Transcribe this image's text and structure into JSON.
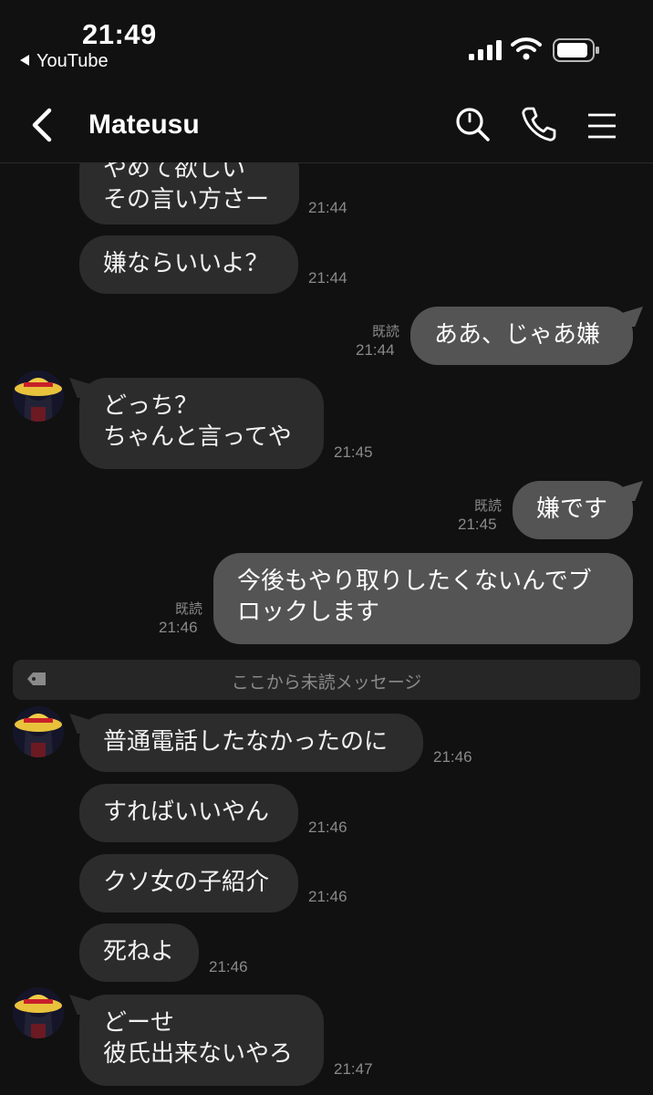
{
  "status_bar": {
    "time": "21:49",
    "back_app": "YouTube"
  },
  "header": {
    "title": "Mateusu"
  },
  "messages": [
    {
      "dir": "in",
      "text": "やめて欲しい\nその言い方さー",
      "time": "21:44"
    },
    {
      "dir": "in",
      "text": "嫌ならいいよ？",
      "time": "21:44"
    },
    {
      "dir": "out",
      "text": "ああ、じゃあ嫌",
      "read": "既読",
      "time": "21:44"
    },
    {
      "dir": "in",
      "text": "どっち？\nちゃんと言ってや",
      "time": "21:45"
    },
    {
      "dir": "out",
      "text": "嫌です",
      "read": "既読",
      "time": "21:45"
    },
    {
      "dir": "out",
      "text": "今後もやり取りしたくないんでブ\nロックします",
      "read": "既読",
      "time": "21:46"
    },
    {
      "dir": "in",
      "text": "普通電話したなかったのに",
      "time": "21:46"
    },
    {
      "dir": "in",
      "text": "すればいいやん",
      "time": "21:46"
    },
    {
      "dir": "in",
      "text": "クソ女の子紹介",
      "time": "21:46"
    },
    {
      "dir": "in",
      "text": "死ねよ",
      "time": "21:46"
    },
    {
      "dir": "in",
      "text": "どーせ\n彼氏出来ないやろ",
      "time": "21:47"
    }
  ],
  "unread_divider": "ここから未読メッセージ",
  "icons": [
    "back-chevron-icon",
    "search-icon",
    "phone-icon",
    "menu-icon",
    "tag-icon"
  ]
}
